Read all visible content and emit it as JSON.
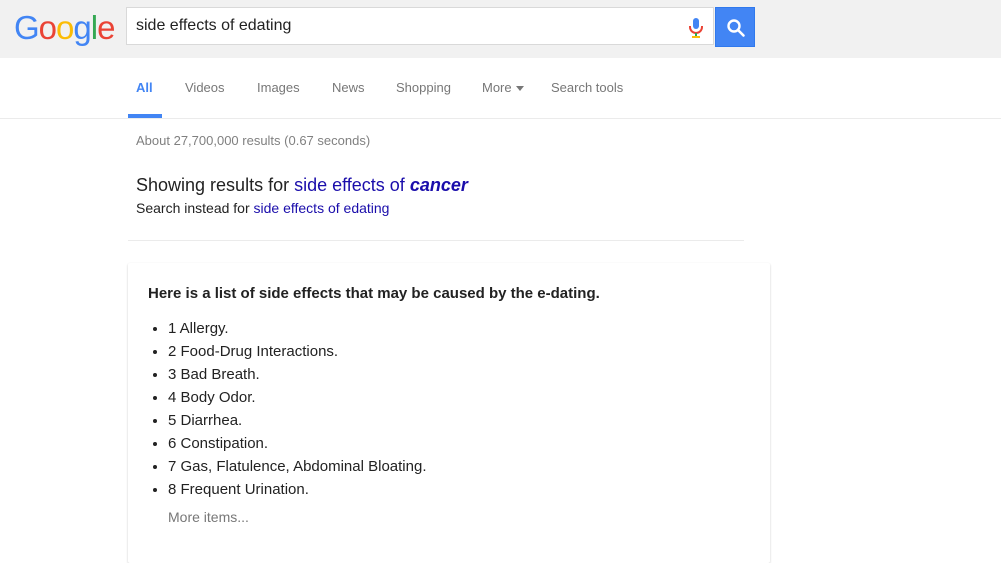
{
  "search": {
    "query": "side effects of edating"
  },
  "logo": {
    "letters": [
      "G",
      "o",
      "o",
      "g",
      "l",
      "e"
    ],
    "colors": [
      "#4285f4",
      "#ea4335",
      "#fbbc05",
      "#4285f4",
      "#34a853",
      "#ea4335"
    ]
  },
  "tabs": [
    {
      "label": "All",
      "active": true
    },
    {
      "label": "Videos"
    },
    {
      "label": "Images"
    },
    {
      "label": "News"
    },
    {
      "label": "Shopping"
    },
    {
      "label": "More"
    },
    {
      "label": "Search tools"
    }
  ],
  "results": {
    "stats": "About 27,700,000 results (0.67 seconds)",
    "showing_prefix": "Showing results for ",
    "showing_link_plain": "side effects of ",
    "showing_link_bold": "cancer",
    "instead_prefix": "Search instead for ",
    "instead_link": "side effects of edating"
  },
  "card": {
    "title": "Here is a list of side effects that may be caused by the e-dating.",
    "items": [
      "1 Allergy.",
      "2 Food-Drug Interactions.",
      "3 Bad Breath.",
      "4 Body Odor.",
      "5 Diarrhea.",
      "6 Constipation.",
      "7 Gas, Flatulence, Abdominal Bloating.",
      "8 Frequent Urination."
    ],
    "more_label": "More items..."
  },
  "colors": {
    "accent": "#4285f4",
    "link": "#1a0dab"
  }
}
